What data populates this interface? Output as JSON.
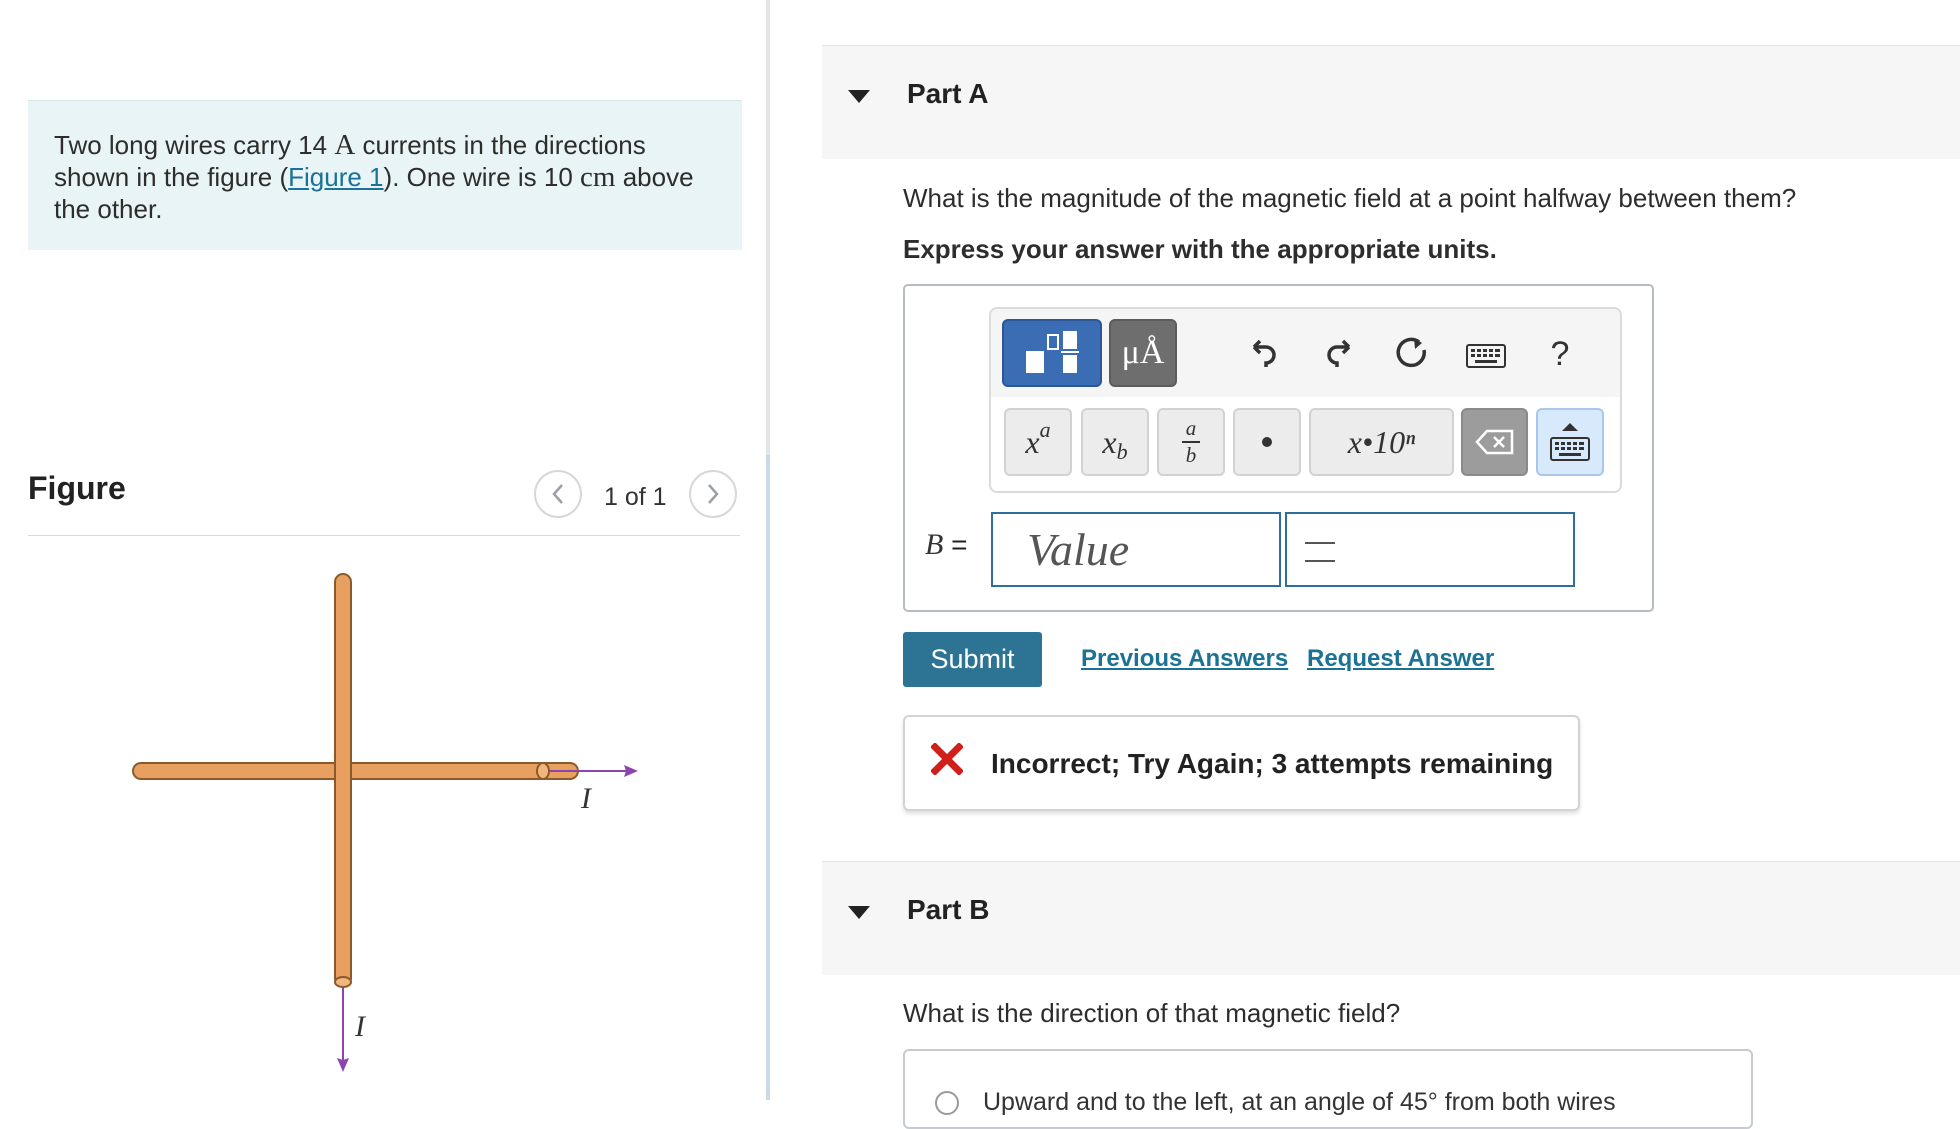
{
  "problem": {
    "text_1": "Two long wires carry 14 ",
    "current_unit": "A",
    "text_2": " currents in the directions shown in the figure (",
    "figure_link": "Figure 1",
    "text_3": "). One wire is 10 ",
    "distance_unit": "cm",
    "text_4": " above the other."
  },
  "figure": {
    "title": "Figure",
    "counter": "1 of 1",
    "current_label_horizontal": "I",
    "current_label_vertical": "I",
    "wire_color": "#e8a061",
    "arrow_color": "#8e44ad"
  },
  "part_a": {
    "title": "Part A",
    "question": "What is the magnitude of the magnetic field at a point halfway between them?",
    "instruction": "Express your answer with the appropriate units.",
    "toolbar": {
      "units_label": "μÅ",
      "help_label": "?",
      "sci_label": "x•10ⁿ",
      "superscript_base": "x",
      "superscript_exp": "a",
      "subscript_base": "x",
      "subscript_sub": "b",
      "fraction_num": "a",
      "fraction_den": "b"
    },
    "variable_label": "B =",
    "value_placeholder": "Value",
    "submit_label": "Submit",
    "previous_answers_label": "Previous Answers",
    "request_answer_label": "Request Answer",
    "feedback": "Incorrect; Try Again; 3 attempts remaining",
    "feedback_color": "#d0201c"
  },
  "part_b": {
    "title": "Part B",
    "question": "What is the direction of that magnetic field?",
    "option_1": "Upward and to the left, at an angle of 45° from both wires"
  },
  "colors": {
    "accent": "#2d7494",
    "link": "#1b7294",
    "problem_bg": "#e8f4f5"
  }
}
